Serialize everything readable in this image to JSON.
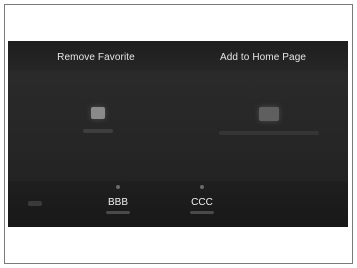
{
  "top_menu": {
    "left_label": "Remove Favorite",
    "right_label": "Add to Home Page"
  },
  "presets": [
    {
      "name": "BBB"
    },
    {
      "name": "CCC"
    }
  ],
  "colors": {
    "screen_bg": "#262626",
    "text": "#e6e6e6"
  }
}
